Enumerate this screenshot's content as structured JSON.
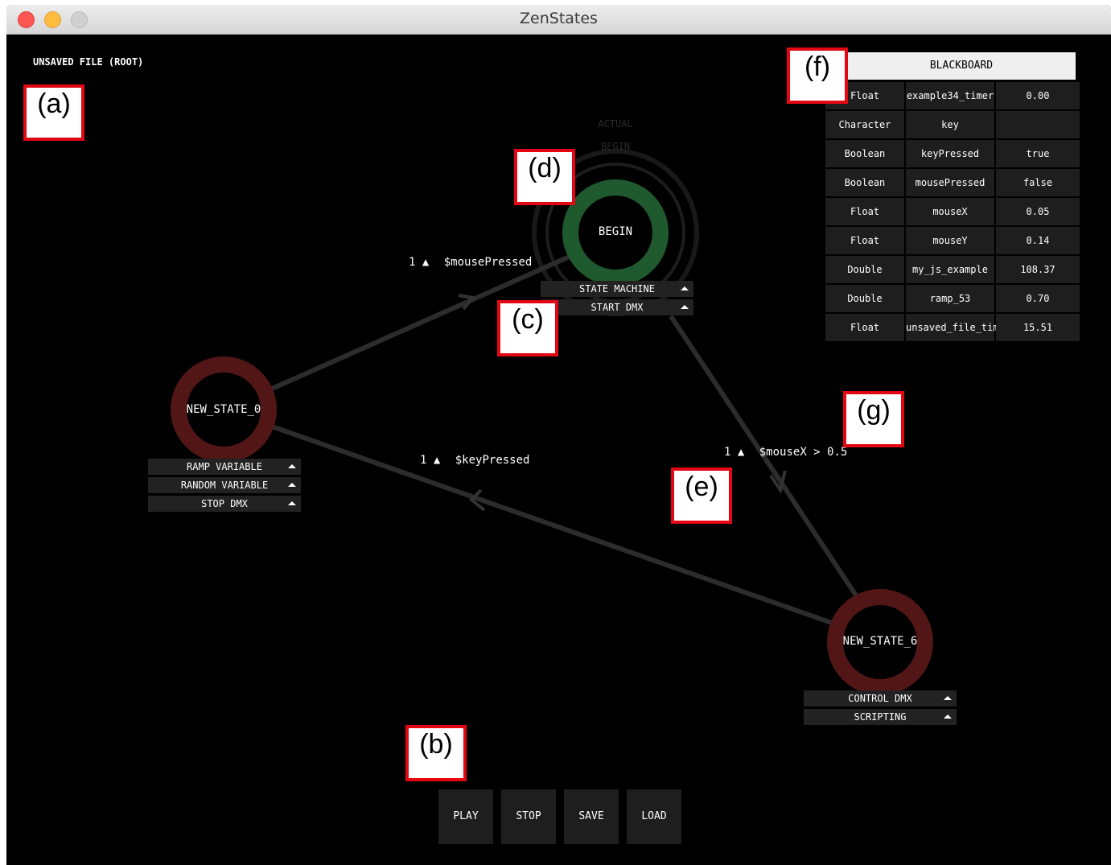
{
  "window": {
    "title": "ZenStates"
  },
  "file_label": "UNSAVED FILE (ROOT)",
  "annotations": {
    "a": "(a)",
    "b": "(b)",
    "c": "(c)",
    "d": "(d)",
    "e": "(e)",
    "f": "(f)",
    "g": "(g)"
  },
  "states": {
    "begin": {
      "label": "BEGIN",
      "faint_labels": [
        "ACTUAL",
        "BEGIN"
      ],
      "actions": [
        "STATE MACHINE",
        "START DMX"
      ],
      "ring_color": "#1f5a2e"
    },
    "state0": {
      "label": "NEW_STATE_0",
      "actions": [
        "RAMP VARIABLE",
        "RANDOM VARIABLE",
        "STOP DMX"
      ],
      "ring_color": "#521616"
    },
    "state6": {
      "label": "NEW_STATE_6",
      "actions": [
        "CONTROL DMX",
        "SCRIPTING"
      ],
      "ring_color": "#521616"
    }
  },
  "transitions": [
    {
      "priority": "1",
      "condition": "$mousePressed"
    },
    {
      "priority": "1",
      "condition": "$keyPressed"
    },
    {
      "priority": "1",
      "condition": "$mouseX > 0.5"
    }
  ],
  "controls": [
    "PLAY",
    "STOP",
    "SAVE",
    "LOAD"
  ],
  "blackboard": {
    "title": "BLACKBOARD",
    "rows": [
      {
        "type": "Float",
        "name": "example34_timer",
        "value": "0.00"
      },
      {
        "type": "Character",
        "name": "key",
        "value": ""
      },
      {
        "type": "Boolean",
        "name": "keyPressed",
        "value": "true"
      },
      {
        "type": "Boolean",
        "name": "mousePressed",
        "value": "false"
      },
      {
        "type": "Float",
        "name": "mouseX",
        "value": "0.05"
      },
      {
        "type": "Float",
        "name": "mouseY",
        "value": "0.14"
      },
      {
        "type": "Double",
        "name": "my_js_example",
        "value": "108.37"
      },
      {
        "type": "Double",
        "name": "ramp_53",
        "value": "0.70"
      },
      {
        "type": "Float",
        "name": "unsaved_file_timer",
        "value": "15.51"
      }
    ]
  },
  "colors": {
    "edge": "#2c2c2c",
    "begin_ring": "#1f5a2e",
    "state_ring": "#521616",
    "annotation_border": "#e30613"
  }
}
